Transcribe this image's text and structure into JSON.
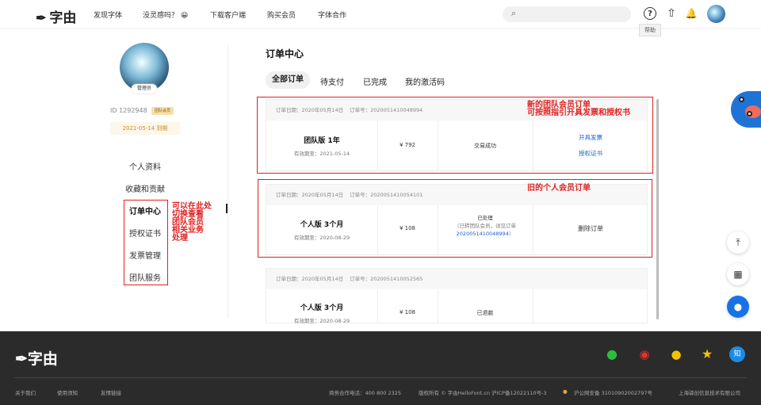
{
  "header": {
    "logo_text": "字由",
    "nav": [
      "发现字体",
      "没灵感吗？",
      "下载客户端",
      "购买会员",
      "字体合作"
    ],
    "inspire_emoji": "😀",
    "search_icon": "⌕",
    "help_tooltip": "帮助",
    "icons": {
      "help": "?",
      "upload": "⇧",
      "bell": "🔔"
    }
  },
  "profile": {
    "avatar_tag": "管理员",
    "id_text": "ID 1292948",
    "badge": "团队会员",
    "expire": "2021-05-14 到期"
  },
  "sidebar": {
    "items": [
      "个人资料",
      "收藏和贡献",
      "订单中心",
      "授权证书",
      "发票管理",
      "团队服务"
    ]
  },
  "annotations": {
    "sidebar_note": [
      "可以在此处",
      "切换查看",
      "团队会员",
      "相关业务",
      "处理"
    ],
    "new_order_note": [
      "新的团队会员订单",
      "可按照指引开具发票和授权书"
    ],
    "old_order_note": [
      "旧的个人会员订单"
    ]
  },
  "main": {
    "title": "订单中心",
    "tabs": [
      "全部订单",
      "待支付",
      "已完成",
      "我的激活码"
    ],
    "orders": [
      {
        "date": "订单日期：2020年05月14日",
        "number": "订单号：2020051410048994",
        "title": "团队版 1年",
        "valid": "有效期至：2021-05-14",
        "price": "¥ 792",
        "status": "交易成功",
        "actions": [
          "开具发票",
          "授权证书"
        ]
      },
      {
        "date": "订单日期：2020年05月14日",
        "number": "订单号：2020051410054101",
        "title": "个人版 3个月",
        "valid": "有效期至：2020-08-29",
        "price": "¥ 108",
        "status": "已处理",
        "status_note": "（已转团队会员，详见订单",
        "status_link": "2020051410048994",
        "status_end": "）",
        "actions": [
          "删除订单"
        ]
      },
      {
        "date": "订单日期：2020年05月14日",
        "number": "订单号：2020051410052565",
        "title": "个人版 3个月",
        "valid": "有效期至：2020-08-29",
        "price": "¥ 108",
        "status": "已退款"
      }
    ]
  },
  "side_buttons": {
    "top": "⤒",
    "qr": "▦",
    "chat": "●"
  },
  "footer": {
    "logo_text": "字由",
    "links": [
      "关于我们",
      "使用须知",
      "友情链接"
    ],
    "phone": "商务合作电话：400 800 2325",
    "copyright": "版权所有 © 字由HelloFont.cn 沪ICP备12022110号-3",
    "police": "沪公网安备 31010902002797号",
    "company": "上海驿创信息技术有限公司",
    "social": [
      "wechat",
      "weibo",
      "qq",
      "qzone",
      "zhihu"
    ],
    "zhihu_label": "知"
  }
}
